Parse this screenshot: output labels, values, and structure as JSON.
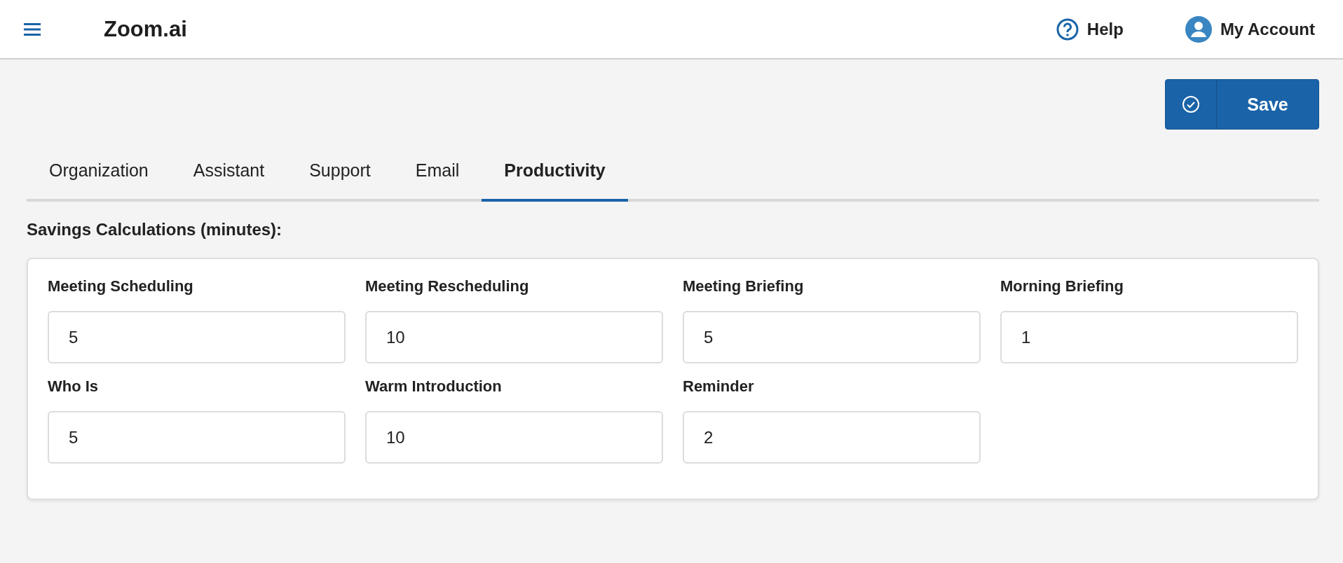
{
  "header": {
    "logo": "Zoom.ai",
    "help": "Help",
    "account": "My Account"
  },
  "save_button": {
    "label": "Save"
  },
  "tabs": [
    {
      "label": "Organization",
      "selected": false
    },
    {
      "label": "Assistant",
      "selected": false
    },
    {
      "label": "Support",
      "selected": false
    },
    {
      "label": "Email",
      "selected": false
    },
    {
      "label": "Productivity",
      "selected": true
    }
  ],
  "section_title": "Savings Calculations (minutes):",
  "fields": [
    {
      "label": "Meeting Scheduling",
      "value": "5"
    },
    {
      "label": "Meeting Rescheduling",
      "value": "10"
    },
    {
      "label": "Meeting Briefing",
      "value": "5"
    },
    {
      "label": "Morning Briefing",
      "value": "1"
    },
    {
      "label": "Who Is",
      "value": "5"
    },
    {
      "label": "Warm Introduction",
      "value": "10"
    },
    {
      "label": "Reminder",
      "value": "2"
    }
  ]
}
